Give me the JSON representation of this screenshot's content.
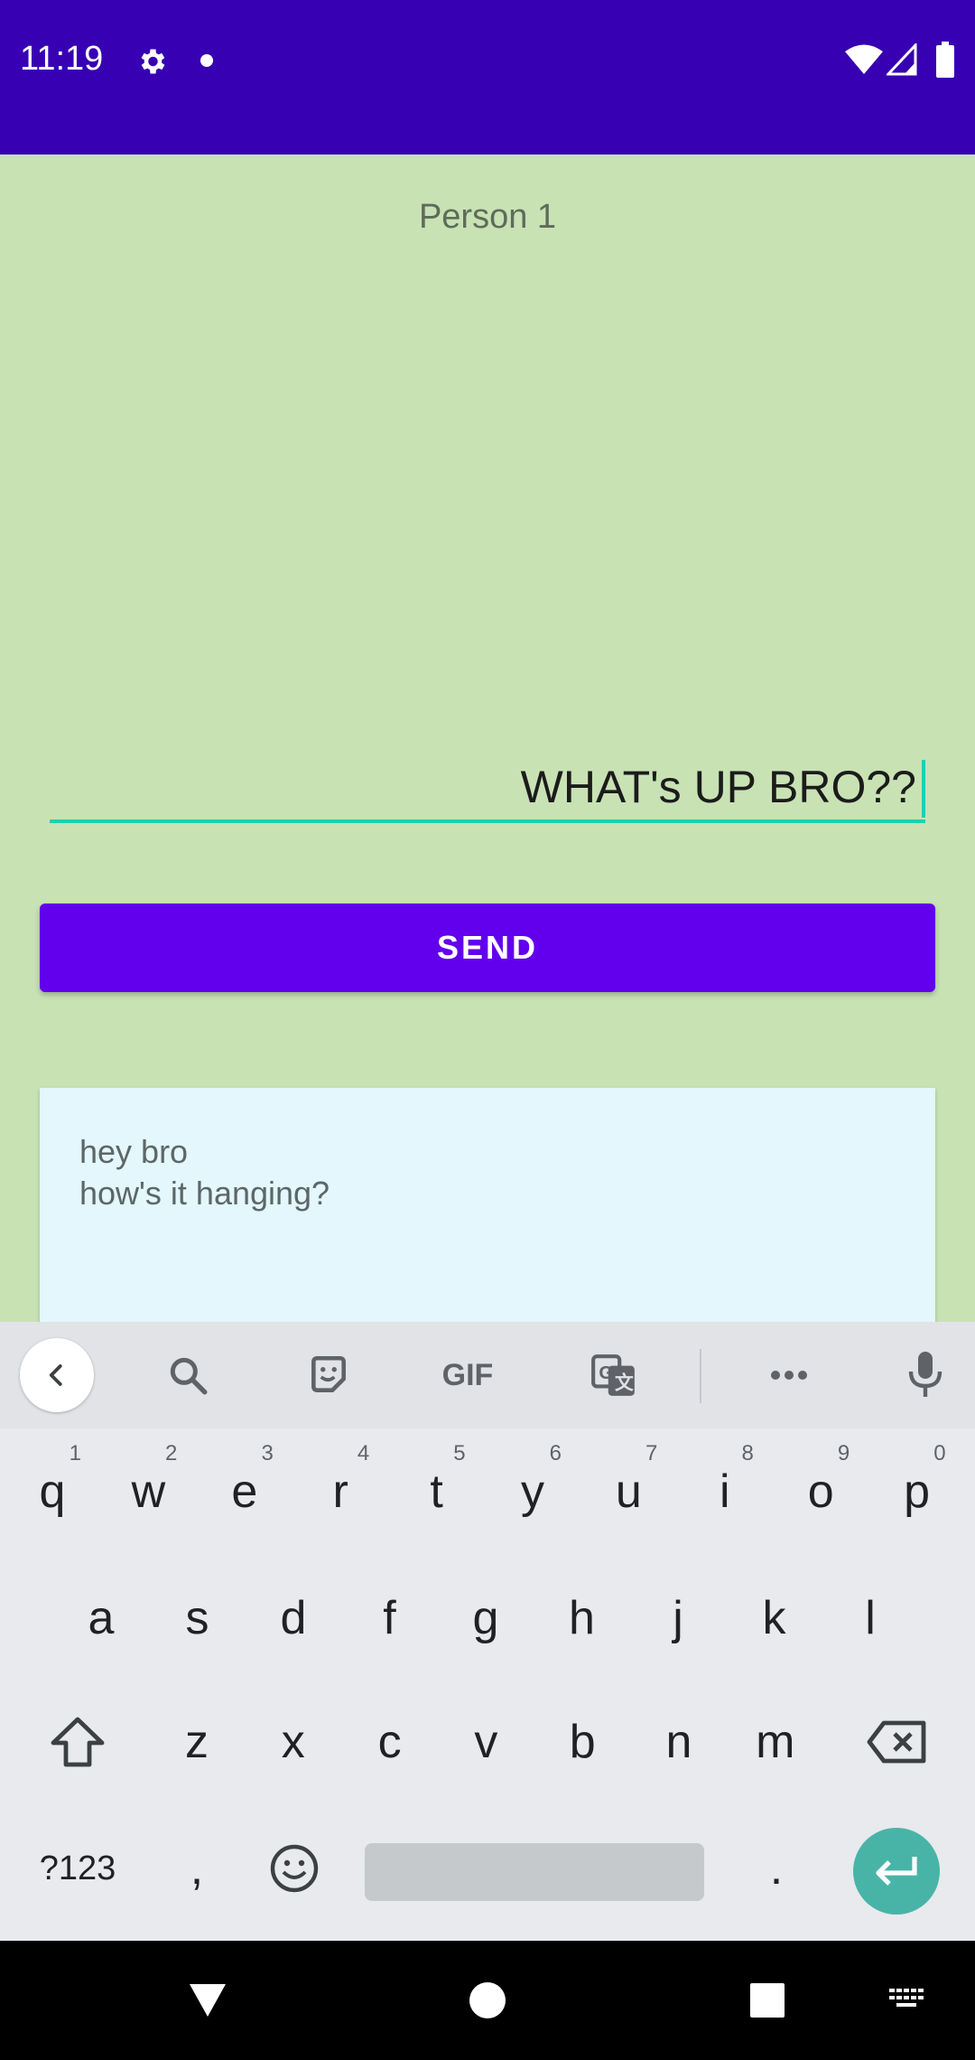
{
  "status_bar": {
    "time": "11:19",
    "icons": [
      "settings-icon",
      "notification-dot-icon",
      "wifi-icon",
      "signal-icon",
      "battery-icon"
    ],
    "background": "#3700B3"
  },
  "screen": {
    "title": "Person 1",
    "message_input": {
      "value": "WHAT's UP BRO??"
    },
    "send_button": {
      "label": "SEND"
    },
    "chat_card": {
      "lines": [
        "hey bro",
        "how's it hanging?"
      ]
    },
    "background": "#C8E2B4",
    "accent": "#6200EE"
  },
  "keyboard": {
    "toolbar_icons": [
      "back-icon",
      "search-icon",
      "sticker-icon",
      "gif-icon",
      "translate-icon",
      "more-icon",
      "mic-icon"
    ],
    "gif_label": "GIF",
    "row1": [
      {
        "k": "q",
        "h": "1"
      },
      {
        "k": "w",
        "h": "2"
      },
      {
        "k": "e",
        "h": "3"
      },
      {
        "k": "r",
        "h": "4"
      },
      {
        "k": "t",
        "h": "5"
      },
      {
        "k": "y",
        "h": "6"
      },
      {
        "k": "u",
        "h": "7"
      },
      {
        "k": "i",
        "h": "8"
      },
      {
        "k": "o",
        "h": "9"
      },
      {
        "k": "p",
        "h": "0"
      }
    ],
    "row2": [
      "a",
      "s",
      "d",
      "f",
      "g",
      "h",
      "j",
      "k",
      "l"
    ],
    "row3": [
      "z",
      "x",
      "c",
      "v",
      "b",
      "n",
      "m"
    ],
    "symbols_label": "?123",
    "comma": ",",
    "period": ".",
    "enter_color": "#48B4A8"
  },
  "nav_bar": {
    "icons": [
      "back-triangle-icon",
      "home-circle-icon",
      "recents-square-icon",
      "keyboard-switch-icon"
    ]
  }
}
